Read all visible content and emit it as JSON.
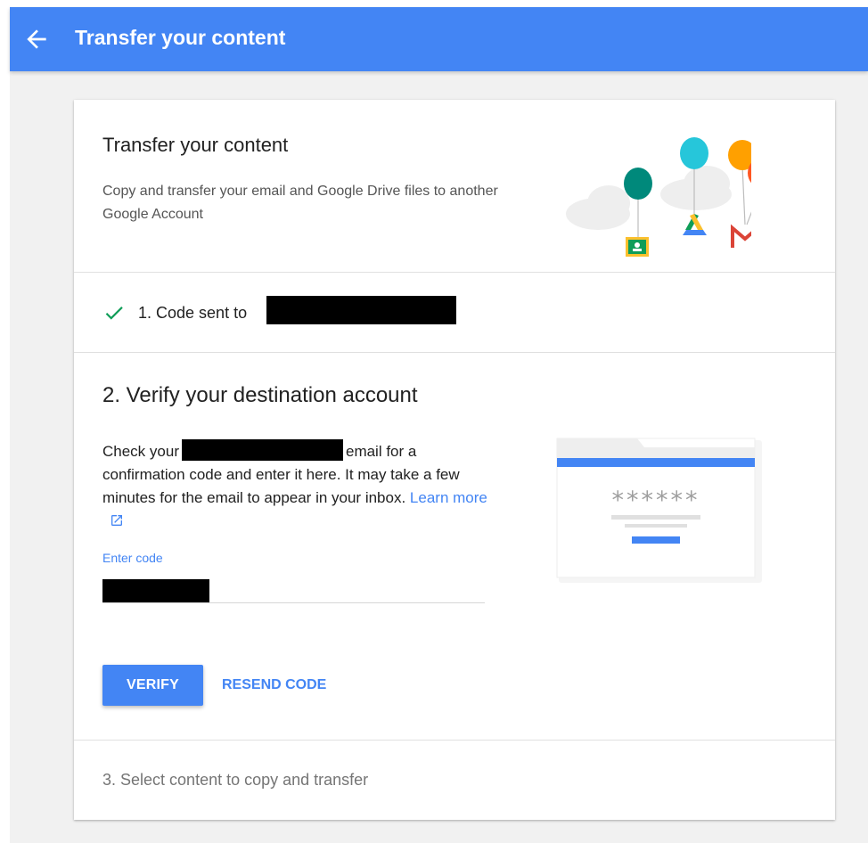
{
  "header": {
    "back_icon": "arrow-back-icon",
    "title": "Transfer your content",
    "color": "#4385f4"
  },
  "intro": {
    "title": "Transfer your content",
    "description": "Copy and transfer your email and Google Drive files to another Google Account",
    "illustration_icons": [
      "classroom-icon",
      "drive-icon",
      "gmail-icon",
      "balloon-icon",
      "cloud-icon"
    ]
  },
  "step1": {
    "icon": "check-icon",
    "label": "1. Code sent to",
    "status_color": "#0f9d58"
  },
  "step2": {
    "title": "2. Verify your destination account",
    "body_before": "Check your",
    "body_after": "email for a confirmation code and enter it here. It may take a few minutes for the email to appear in your inbox.",
    "learn_more": "Learn more",
    "code_label": "Enter code",
    "verify_button": "VERIFY",
    "resend_button": "RESEND CODE",
    "illustration_masked_code": "******"
  },
  "step3": {
    "label": "3. Select content to copy and transfer"
  }
}
